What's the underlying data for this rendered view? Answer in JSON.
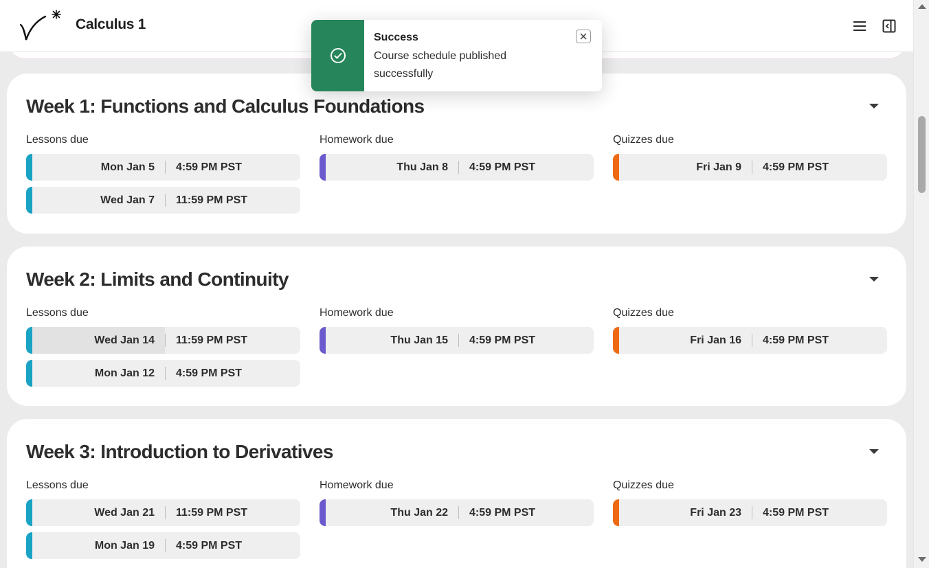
{
  "header": {
    "title": "Calculus 1",
    "logo": "v-star-logo",
    "menu_icon": "hamburger-icon",
    "panel_icon": "sidebar-panel-icon"
  },
  "colors": {
    "lessons": "#1aa3c4",
    "homework": "#6a5acd",
    "quizzes": "#ee6a12",
    "success": "#26855a"
  },
  "toast": {
    "title": "Success",
    "message": "Course schedule published successfully",
    "icon": "check-circle-icon",
    "close_icon": "close-icon"
  },
  "weeks": [
    {
      "title": "Week 1: Functions and Calculus Foundations",
      "lessons_label": "Lessons due",
      "homework_label": "Homework due",
      "quizzes_label": "Quizzes due",
      "lessons": [
        {
          "date": "Mon Jan 5",
          "time": "4:59 PM PST"
        },
        {
          "date": "Wed Jan 7",
          "time": "11:59 PM PST"
        }
      ],
      "homework": [
        {
          "date": "Thu Jan 8",
          "time": "4:59 PM PST"
        }
      ],
      "quizzes": [
        {
          "date": "Fri Jan 9",
          "time": "4:59 PM PST"
        }
      ]
    },
    {
      "title": "Week 2: Limits and Continuity",
      "lessons_label": "Lessons due",
      "homework_label": "Homework due",
      "quizzes_label": "Quizzes due",
      "lessons": [
        {
          "date": "Wed Jan 14",
          "time": "11:59 PM PST"
        },
        {
          "date": "Mon Jan 12",
          "time": "4:59 PM PST"
        }
      ],
      "homework": [
        {
          "date": "Thu Jan 15",
          "time": "4:59 PM PST"
        }
      ],
      "quizzes": [
        {
          "date": "Fri Jan 16",
          "time": "4:59 PM PST"
        }
      ]
    },
    {
      "title": "Week 3: Introduction to Derivatives",
      "lessons_label": "Lessons due",
      "homework_label": "Homework due",
      "quizzes_label": "Quizzes due",
      "lessons": [
        {
          "date": "Wed Jan 21",
          "time": "11:59 PM PST"
        },
        {
          "date": "Mon Jan 19",
          "time": "4:59 PM PST"
        }
      ],
      "homework": [
        {
          "date": "Thu Jan 22",
          "time": "4:59 PM PST"
        }
      ],
      "quizzes": [
        {
          "date": "Fri Jan 23",
          "time": "4:59 PM PST"
        }
      ]
    }
  ]
}
